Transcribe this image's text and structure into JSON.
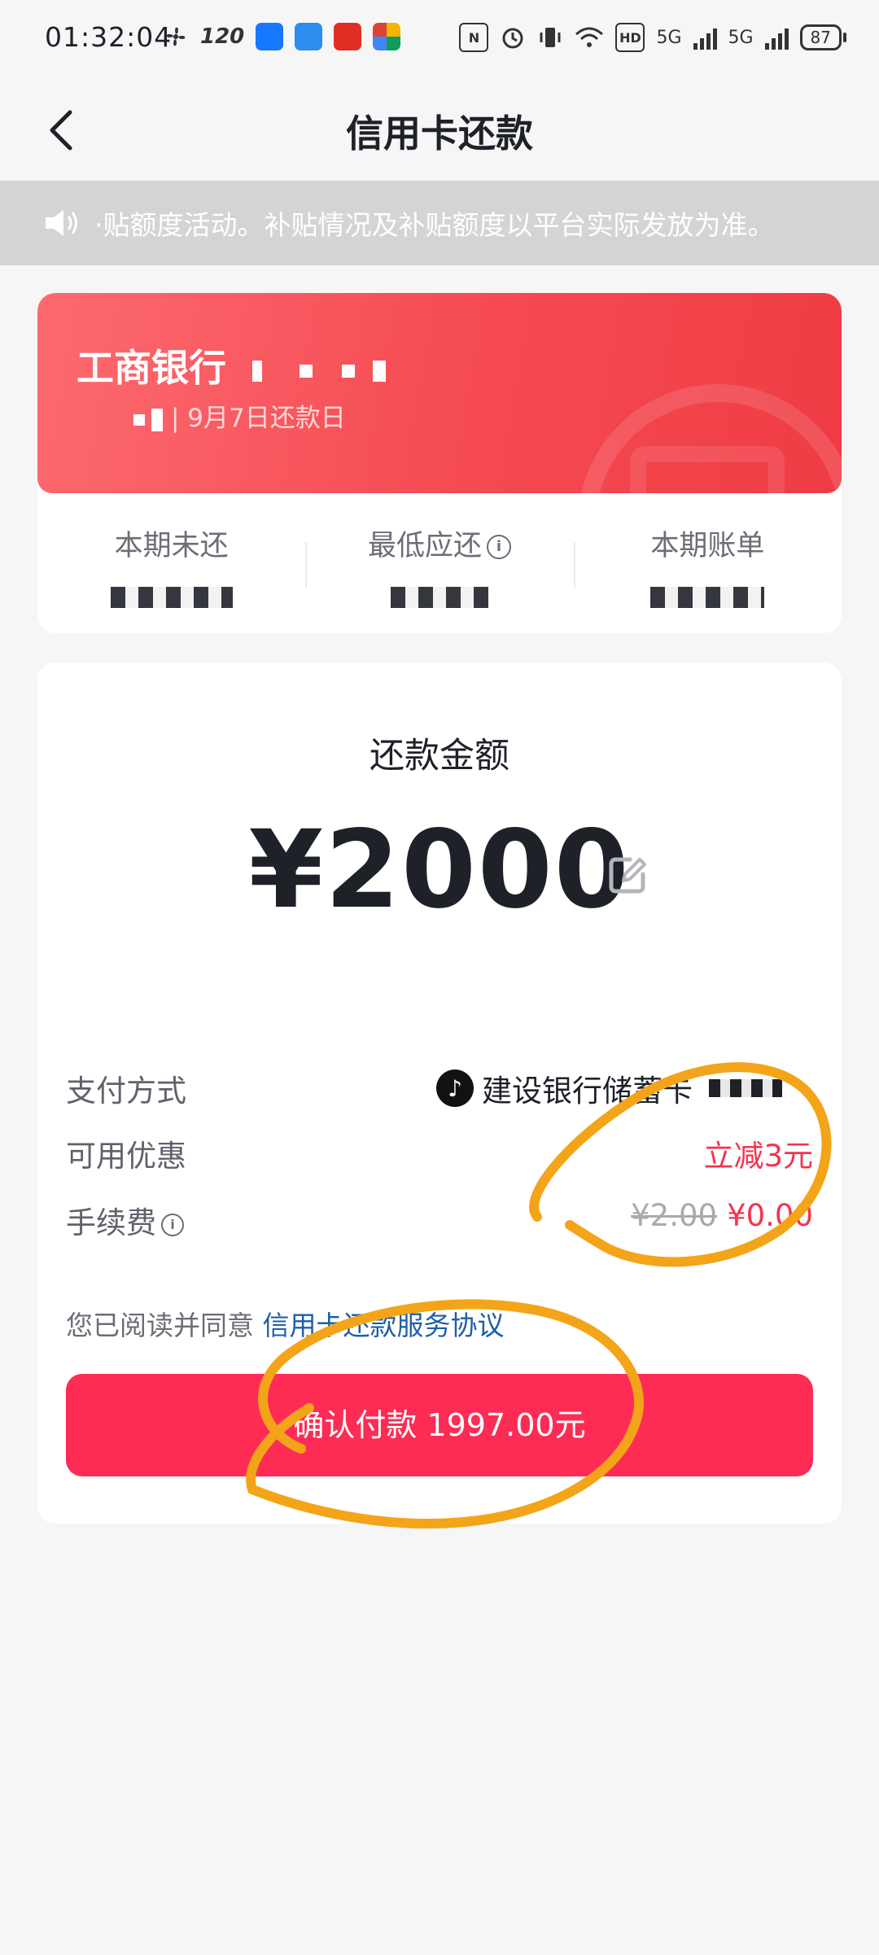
{
  "status_bar": {
    "time": "01:32:04",
    "refresh_rate": "120",
    "battery": "87",
    "network_1": "5G",
    "network_2": "5G"
  },
  "header": {
    "title": "信用卡还款",
    "back_icon": "chevron-left-icon"
  },
  "notice": {
    "icon": "speaker-icon",
    "text": "·贴额度活动。补贴情况及补贴额度以平台实际发放为准。"
  },
  "card": {
    "bank_name": "工商银行",
    "due_text": "| 9月7日还款日",
    "stats": [
      {
        "label": "本期未还"
      },
      {
        "label": "最低应还"
      },
      {
        "label": "本期账单"
      }
    ],
    "accent_color": "#f54a52"
  },
  "payment": {
    "amount_label": "还款金额",
    "amount": "¥2000",
    "method_label": "支付方式",
    "method_value": "建设银行储蓄卡",
    "discount_label": "可用优惠",
    "discount_value": "立减3元",
    "fee_label": "手续费",
    "fee_old": "¥2.00",
    "fee_new": "¥0.00",
    "agree_text": "您已阅读并同意",
    "agree_link": "信用卡还款服务协议",
    "confirm_label": "确认付款 1997.00元",
    "confirm_color": "#fe2c55",
    "highlight_color": "#f2344f",
    "annotation_color": "#f4a418"
  }
}
